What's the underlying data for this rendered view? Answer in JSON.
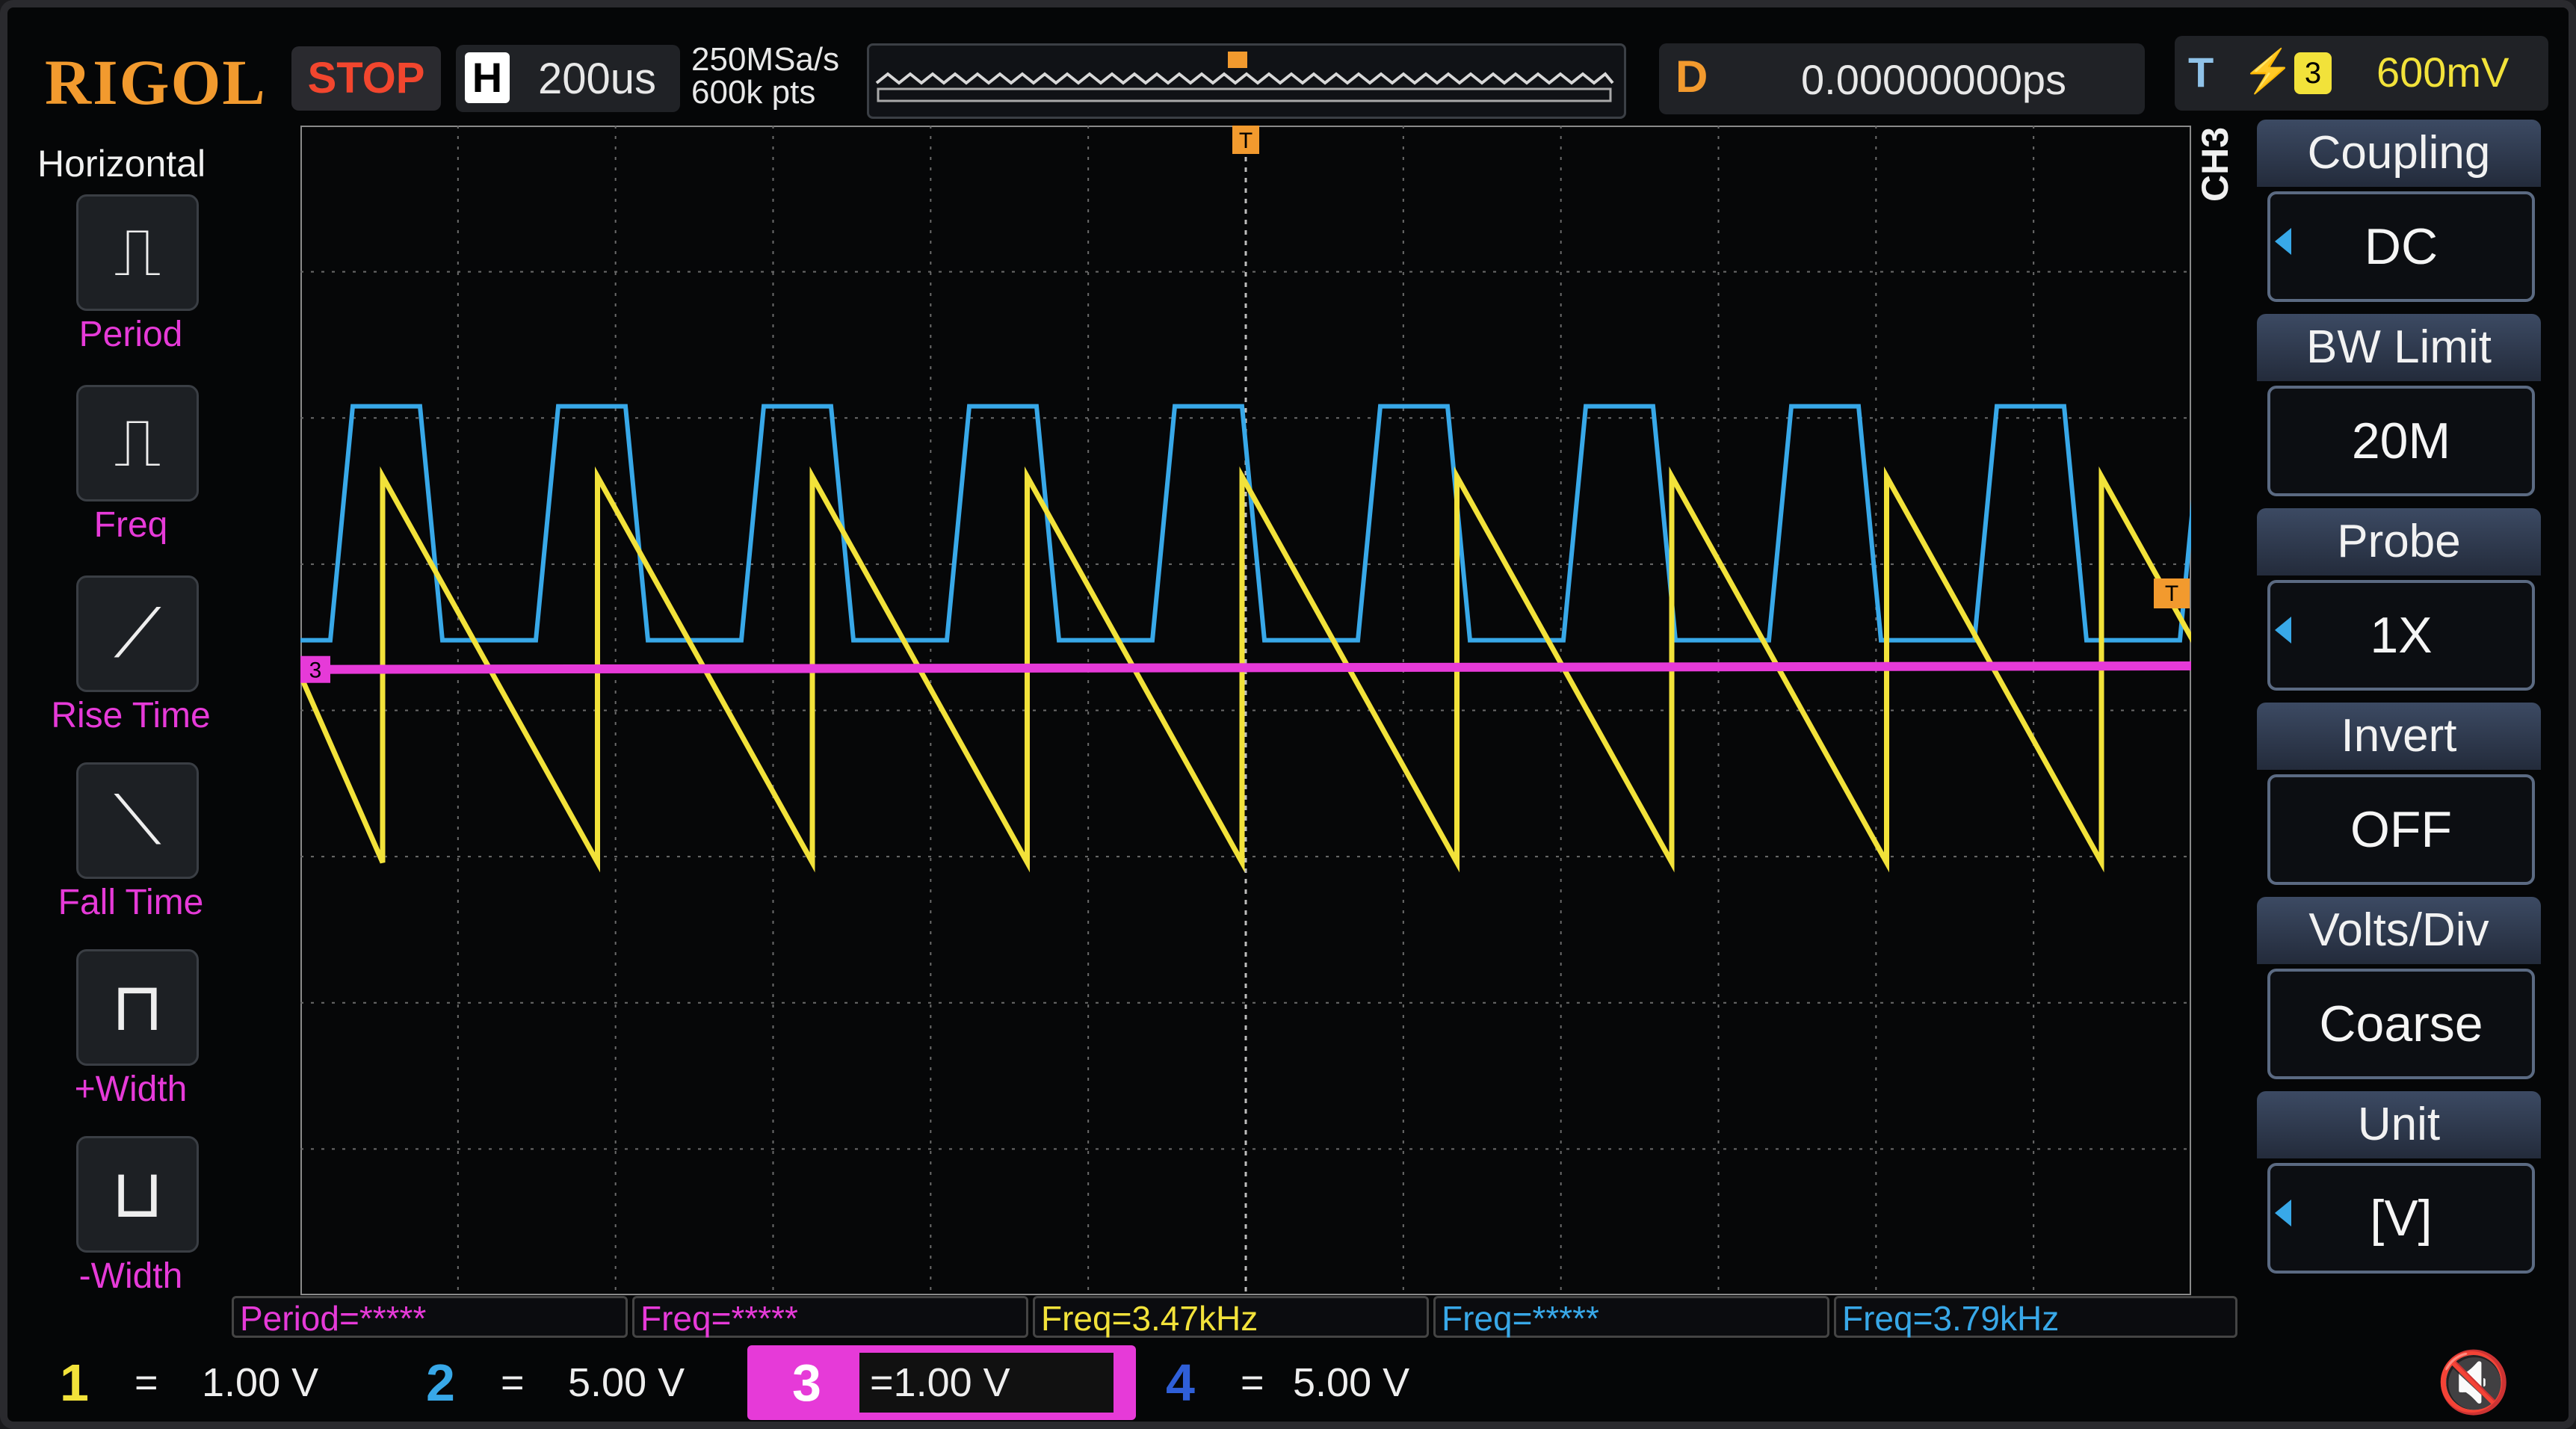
{
  "header": {
    "logo": "RIGOL",
    "run_state": "STOP",
    "horizontal_label": "H",
    "timebase": "200us",
    "sample_rate": "250MSa/s",
    "memory_depth": "600k pts",
    "delay_label": "D",
    "delay_value": "0.00000000ps",
    "trigger_type": "T",
    "trigger_edge_icon": "rising-edge-icon",
    "trigger_source": "3",
    "trigger_level": "600mV"
  },
  "left_panel": {
    "title": "Horizontal",
    "items": [
      {
        "label": "Period",
        "icon": "period-icon"
      },
      {
        "label": "Freq",
        "icon": "freq-icon"
      },
      {
        "label": "Rise Time",
        "icon": "rise-time-icon"
      },
      {
        "label": "Fall Time",
        "icon": "fall-time-icon"
      },
      {
        "label": "+Width",
        "icon": "pos-width-icon"
      },
      {
        "label": "-Width",
        "icon": "neg-width-icon"
      }
    ]
  },
  "right_menu": {
    "channel": "CH3",
    "items": [
      {
        "title": "Coupling",
        "value": "DC"
      },
      {
        "title": "BW Limit",
        "value": "20M"
      },
      {
        "title": "Probe",
        "value": "1X"
      },
      {
        "title": "Invert",
        "value": "OFF"
      },
      {
        "title": "Volts/Div",
        "value": "Coarse"
      },
      {
        "title": "Unit",
        "value": "[V]"
      }
    ]
  },
  "measurements": [
    {
      "text": "Period=*****",
      "color": "#e63ad8"
    },
    {
      "text": "Freq=*****",
      "color": "#e63ad8"
    },
    {
      "text": "Freq=3.47kHz",
      "color": "#f2e23a"
    },
    {
      "text": "Freq=*****",
      "color": "#38a8e8"
    },
    {
      "text": "Freq=3.79kHz",
      "color": "#38a8e8"
    }
  ],
  "channels": [
    {
      "num": "1",
      "coupling_symbol": "=",
      "scale": "1.00 V",
      "color": "#f2e23a"
    },
    {
      "num": "2",
      "coupling_symbol": "=",
      "scale": "5.00 V",
      "color": "#38a8e8"
    },
    {
      "num": "3",
      "coupling_symbol": "=",
      "scale": "1.00 V",
      "color": "#e63ad8"
    },
    {
      "num": "4",
      "coupling_symbol": "=",
      "scale": "5.00 V",
      "color": "#2f5fd8"
    }
  ],
  "markers": {
    "trigger_top": "T",
    "trigger_right": "T",
    "ch3_marker": "3"
  },
  "colors": {
    "ch1": "#f2e23a",
    "ch2": "#38a8e8",
    "ch3": "#e63ad8",
    "ch4": "#2f5fd8",
    "trigger_marker": "#f29a2e"
  }
}
